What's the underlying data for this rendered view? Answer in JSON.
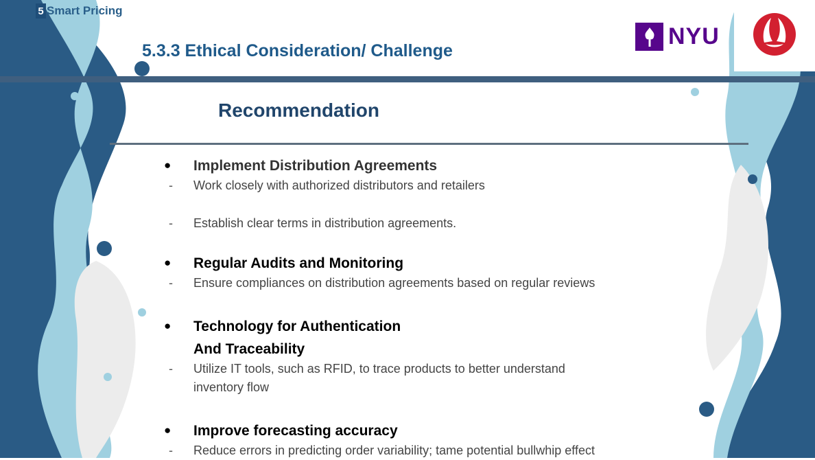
{
  "section": {
    "number": "5",
    "label": "Smart Pricing"
  },
  "slide_title": "5.3.3 Ethical Consideration/ Challenge",
  "heading": "Recommendation",
  "logos": {
    "nyu_text": "NYU",
    "nyu_color": "#57068c",
    "lulu_color": "#d22030"
  },
  "colors": {
    "dark_blue": "#2a5b85",
    "light_blue": "#9fd0e0",
    "light_gray": "#ececec"
  },
  "bullet_glyph": "●",
  "dash_glyph": "-",
  "items": [
    {
      "title": "Implement Distribution Agreements",
      "details": [
        "Work closely with authorized distributors and retailers",
        "Establish clear terms in distribution agreements."
      ]
    },
    {
      "title": "Regular Audits and Monitoring",
      "details": [
        "Ensure compliances on distribution agreements based on regular reviews"
      ]
    },
    {
      "title": "Technology for Authentication And Traceability",
      "title_lines": [
        "Technology for Authentication",
        "And Traceability"
      ],
      "details": [
        "Utilize IT tools, such as RFID, to trace products to better understand inventory flow"
      ]
    },
    {
      "title": "Improve forecasting accuracy",
      "details": [
        "Reduce errors in predicting order variability; tame potential bullwhip effect"
      ]
    }
  ]
}
